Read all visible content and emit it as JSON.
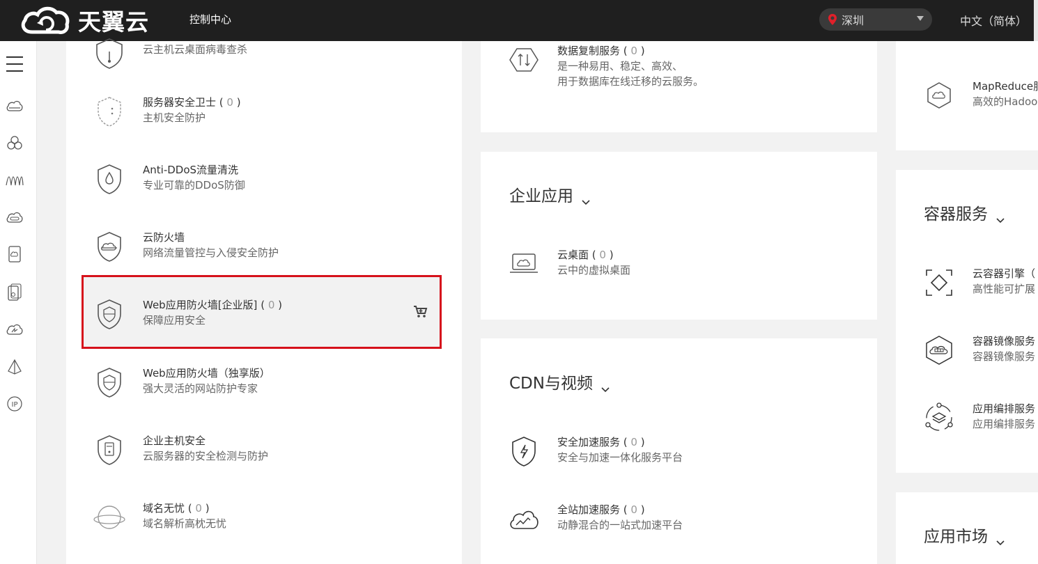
{
  "header": {
    "logo_text": "天翼云",
    "console_label": "控制中心",
    "region": "深圳",
    "language": "中文（简体）"
  },
  "left_nav": {
    "icons": [
      "cloud-drive-icon",
      "cluster-icon",
      "waves-icon",
      "server-icon",
      "device-icon",
      "multi-device-icon",
      "cloud-speed-icon",
      "pyramid-icon",
      "ip-icon"
    ]
  },
  "column1": {
    "items": [
      {
        "title": "",
        "desc": "云主机云桌面病毒查杀",
        "icon": "shield-antivirus-icon"
      },
      {
        "title": "服务器安全卫士",
        "count": "0",
        "desc": "主机安全防护",
        "icon": "shield-dots-icon"
      },
      {
        "title": "Anti-DDoS流量清洗",
        "desc": "专业可靠的DDoS防御",
        "icon": "shield-drop-icon"
      },
      {
        "title": "云防火墙",
        "desc": "网络流量管控与入侵安全防护",
        "icon": "shield-firewall-icon"
      },
      {
        "title": "Web应用防火墙[企业版]",
        "count": "0",
        "desc": "保障应用安全",
        "icon": "shield-web-icon"
      },
      {
        "title": "Web应用防火墙（独享版）",
        "desc": "强大灵活的网站防护专家",
        "icon": "shield-web-exclusive-icon"
      },
      {
        "title": "企业主机安全",
        "desc": "云服务器的安全检测与防护",
        "icon": "shield-host-icon"
      },
      {
        "title": "域名无忧",
        "count": "0",
        "desc": "域名解析高枕无忧",
        "icon": "domain-globe-icon"
      }
    ]
  },
  "column2": {
    "top_item": {
      "title": "数据复制服务",
      "count": "0",
      "desc1": "是一种易用、稳定、高效、",
      "desc2": "用于数据库在线迁移的云服务。",
      "icon": "data-replication-icon"
    },
    "sections": [
      {
        "title": "企业应用",
        "items": [
          {
            "title": "云桌面",
            "count": "0",
            "desc": "云中的虚拟桌面",
            "icon": "cloud-desktop-icon"
          }
        ]
      },
      {
        "title": "CDN与视频",
        "items": [
          {
            "title": "安全加速服务",
            "count": "0",
            "desc": "安全与加速一体化服务平台",
            "icon": "shield-bolt-icon"
          },
          {
            "title": "全站加速服务",
            "count": "0",
            "desc": "动静混合的一站式加速平台",
            "icon": "cloud-chart-icon"
          }
        ]
      }
    ]
  },
  "column3": {
    "top_item": {
      "title": "MapReduce服",
      "desc": "高效的Hadoo",
      "icon": "mapreduce-icon"
    },
    "sections": [
      {
        "title": "容器服务",
        "items": [
          {
            "title": "云容器引擎（",
            "desc": "高性能可扩展",
            "icon": "container-engine-icon"
          },
          {
            "title": "容器镜像服务",
            "desc": "容器镜像服务",
            "icon": "container-image-icon"
          },
          {
            "title": "应用编排服务",
            "desc": "应用编排服务",
            "icon": "app-orchestration-icon"
          }
        ]
      },
      {
        "title": "应用市场",
        "items": []
      }
    ]
  },
  "colors": {
    "accent": "#d6111b",
    "topbar": "#1f1f1f",
    "pin": "#e0202a"
  }
}
